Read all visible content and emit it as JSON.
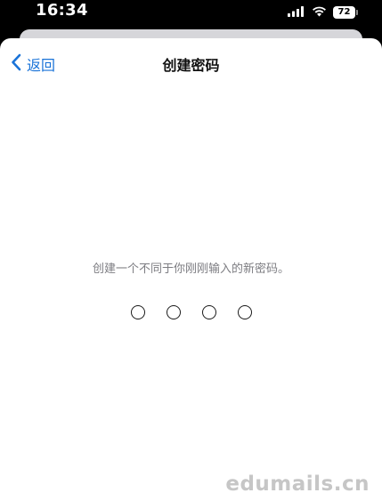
{
  "status_bar": {
    "time": "16:34",
    "battery": "72",
    "icons": [
      "cellular-signal-icon",
      "wifi-icon",
      "battery-icon"
    ]
  },
  "nav": {
    "back_label": "返回",
    "title": "创建密码"
  },
  "content": {
    "instruction": "创建一个不同于你刚刚输入的新密码。",
    "pin_length": 4,
    "pin_filled": 0
  },
  "watermark": "edumails.cn",
  "colors": {
    "accent": "#1a73d8",
    "background": "#ffffff",
    "instruction_text": "#7d7d82"
  }
}
